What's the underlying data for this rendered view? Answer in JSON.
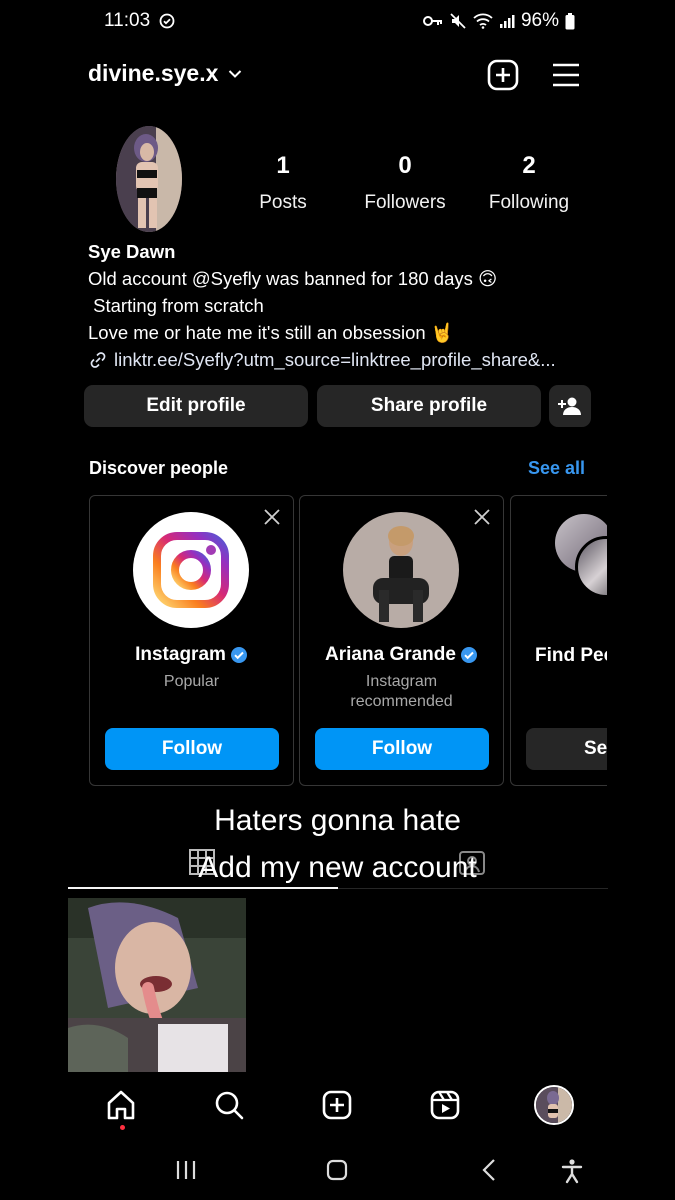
{
  "status_bar": {
    "time": "11:03",
    "battery": "96%"
  },
  "header": {
    "username": "divine.sye.x",
    "icons": [
      "chevron-down-icon",
      "create-post-icon",
      "menu-icon"
    ]
  },
  "profile": {
    "stats": [
      {
        "count": "1",
        "label": "Posts"
      },
      {
        "count": "0",
        "label": "Followers"
      },
      {
        "count": "2",
        "label": "Following"
      }
    ],
    "display_name": "Sye Dawn",
    "bio_lines": [
      "Old account @Syefly was banned for 180 days 🙃",
      " Starting from scratch",
      "Love me or hate me it's still an obsession 🤘"
    ],
    "link": "linktr.ee/Syefly?utm_source=linktree_profile_share&..."
  },
  "actions": {
    "edit_profile": "Edit profile",
    "share_profile": "Share profile"
  },
  "discover": {
    "title": "Discover people",
    "see_all": "See all",
    "cards": [
      {
        "name": "Instagram",
        "subtitle": "Popular",
        "button": "Follow",
        "verified": true
      },
      {
        "name": "Ariana Grande",
        "subtitle": "Instagram recommended",
        "button": "Follow",
        "verified": true
      },
      {
        "name": "Find People t",
        "subtitle": "",
        "button": "Se",
        "verified": false
      }
    ]
  },
  "overlay": {
    "line1": "Haters gonna hate",
    "line2": "Add my new account"
  },
  "bottom_nav": [
    "home-icon",
    "search-icon",
    "create-icon",
    "reels-icon",
    "profile-avatar"
  ],
  "colors": {
    "background": "#000000",
    "button_gray": "#262626",
    "follow_blue": "#0095f6",
    "link_blue": "#3897f0",
    "notification_red": "#ff3040"
  }
}
